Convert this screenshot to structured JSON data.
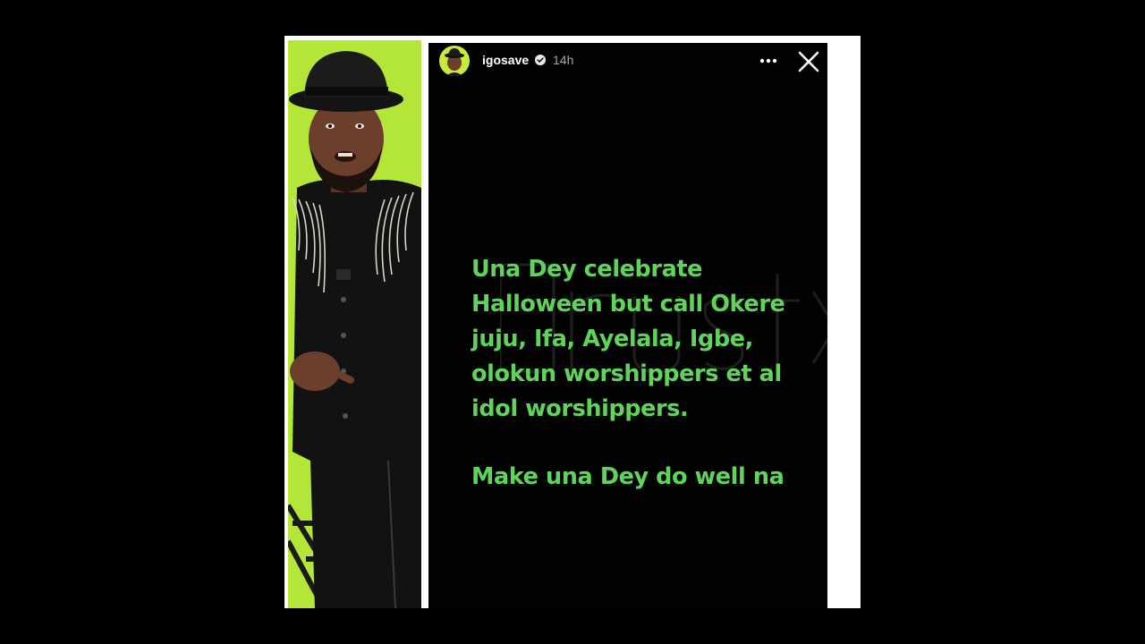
{
  "story": {
    "username": "igosave",
    "time": "14h",
    "caption": "Una Dey celebrate\nHalloween but call Okere\njuju, Ifa, Ayelala, Igbe,\nolokun worshippers et al\nidol worshippers.",
    "closing": "Make una Dey do well na",
    "text_color": "#5fd35a",
    "background_color": "#020202"
  },
  "icons": {
    "verified": "verified-badge-icon",
    "more": "more-options-icon",
    "close": "close-icon"
  },
  "photo": {
    "background_color": "#b4e63a"
  }
}
